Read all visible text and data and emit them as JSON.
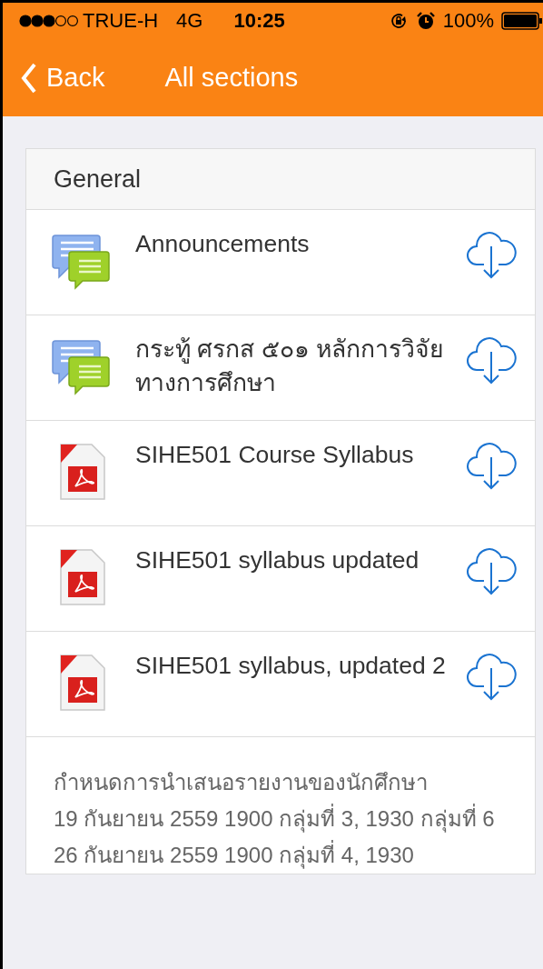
{
  "status_bar": {
    "carrier": "TRUE-H",
    "network": "4G",
    "time": "10:25",
    "battery": "100%"
  },
  "nav_bar": {
    "back": "Back",
    "title": "All sections"
  },
  "section": {
    "title": "General",
    "items": [
      {
        "kind": "forum",
        "label": "Announcements"
      },
      {
        "kind": "forum",
        "label": "กระทู้ ศรกส ๕๐๑ หลักการวิจัยทางการศึกษา"
      },
      {
        "kind": "pdf",
        "label": "SIHE501 Course Syllabus"
      },
      {
        "kind": "pdf",
        "label": "SIHE501 syllabus updated"
      },
      {
        "kind": "pdf",
        "label": "SIHE501 syllabus, updated 2"
      }
    ],
    "summary": [
      "กำหนดการนำเสนอรายงานของนักศึกษา",
      "19 กันยายน 2559   1900 กลุ่มที่ 3, 1930 กลุ่มที่ 6",
      "26 กันยายน 2559   1900 กลุ่มที่ 4, 1930"
    ]
  }
}
